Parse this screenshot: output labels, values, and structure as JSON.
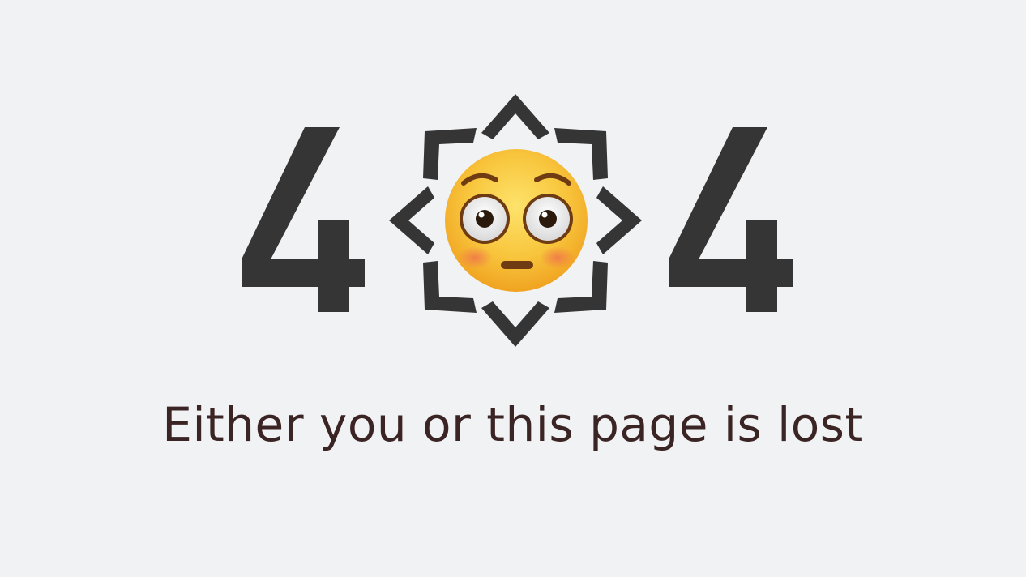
{
  "error": {
    "code_left_digit": "4",
    "code_right_digit": "4",
    "center_icon": "flushed-face-emoji",
    "badge_icon": "sun-badge-icon",
    "message": "Either you or this page is lost"
  },
  "colors": {
    "background": "#f1f2f4",
    "digit": "#353535",
    "badge": "#353535",
    "message": "#3b2424",
    "emoji_face": "#f7c53a"
  }
}
